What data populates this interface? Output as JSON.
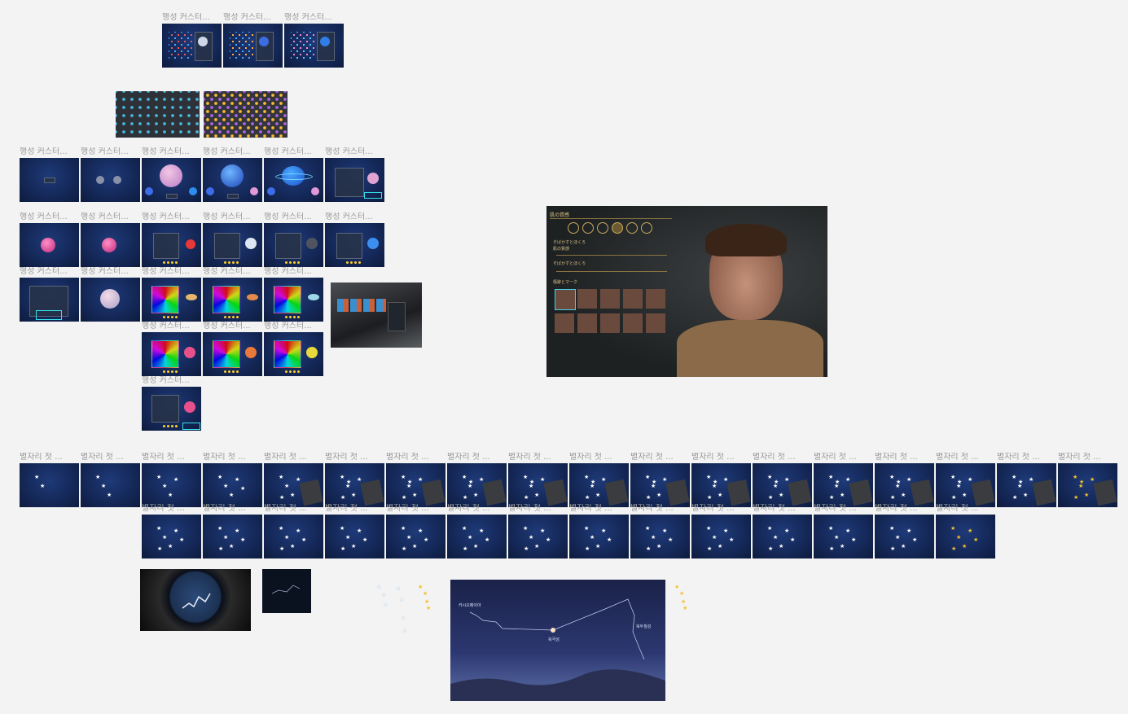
{
  "frame_labels": {
    "planet": "행성 커스터...",
    "constellation": "별자리 첫 ..."
  },
  "character_panel": {
    "title": "肌の質感",
    "slider1_heading": "そばかすとほくろ",
    "slider1_label": "肌の質感",
    "slider2_label": "そばかすとほくろ",
    "section_label": "傷跡とマーク"
  },
  "sky_scene": {
    "label_left": "카시오페이아",
    "label_center": "북극성",
    "label_right": "북두칠성"
  },
  "colors": {
    "canvas_bg": "#f3f3f3",
    "frame_label": "#9a9a9a",
    "frame_bg": "#15295a",
    "accent_gold": "#f2c230",
    "accent_cyan": "#35e0e8"
  }
}
